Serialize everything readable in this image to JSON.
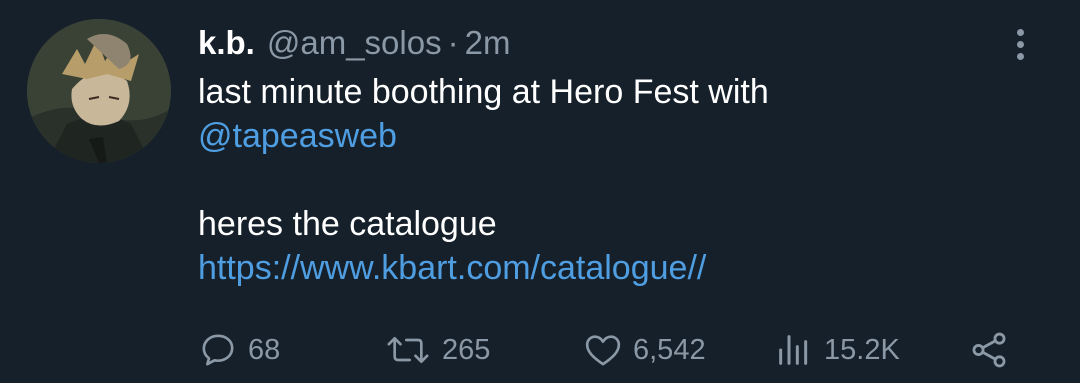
{
  "tweet": {
    "author": {
      "name": "k.b.",
      "handle": "@am_solos",
      "separator": "·",
      "time": "2m",
      "avatar_icon": "avatar-illustration"
    },
    "text": {
      "line1": "last minute boothing at Hero Fest with",
      "mention": "@tapeasweb",
      "line3": "heres the catalogue",
      "link": "https://www.kbart.com/catalogue//"
    },
    "actions": {
      "reply": {
        "icon": "reply-icon",
        "count": "68"
      },
      "retweet": {
        "icon": "retweet-icon",
        "count": "265"
      },
      "like": {
        "icon": "heart-icon",
        "count": "6,542"
      },
      "views": {
        "icon": "views-icon",
        "count": "15.2K"
      },
      "share": {
        "icon": "share-icon"
      }
    },
    "more_icon": "more-options-icon"
  },
  "colors": {
    "background": "#15202b",
    "primary_text": "#ffffff",
    "secondary_text": "#8b98a5",
    "link": "#4f9ee2"
  }
}
